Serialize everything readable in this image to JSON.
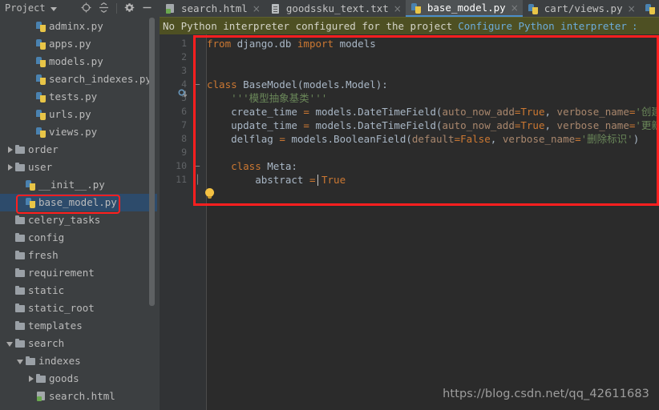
{
  "project_panel": {
    "title": "Project",
    "toolbar_icons": [
      {
        "name": "locate-icon",
        "glyph": "target"
      },
      {
        "name": "collapse-all-icon",
        "glyph": "collapse"
      },
      {
        "name": "settings-gear-icon",
        "glyph": "gear"
      },
      {
        "name": "hide-panel-icon",
        "glyph": "minus"
      }
    ],
    "tree": [
      {
        "label": "adminx.py",
        "icon": "python-file-icon",
        "indent": 3,
        "arrow": "none",
        "selected": false
      },
      {
        "label": "apps.py",
        "icon": "python-file-icon",
        "indent": 3,
        "arrow": "none",
        "selected": false
      },
      {
        "label": "models.py",
        "icon": "python-file-icon",
        "indent": 3,
        "arrow": "none",
        "selected": false
      },
      {
        "label": "search_indexes.py",
        "icon": "python-file-icon",
        "indent": 3,
        "arrow": "none",
        "selected": false
      },
      {
        "label": "tests.py",
        "icon": "python-file-icon",
        "indent": 3,
        "arrow": "none",
        "selected": false
      },
      {
        "label": "urls.py",
        "icon": "python-file-icon",
        "indent": 3,
        "arrow": "none",
        "selected": false
      },
      {
        "label": "views.py",
        "icon": "python-file-icon",
        "indent": 3,
        "arrow": "none",
        "selected": false
      },
      {
        "label": "order",
        "icon": "folder-icon",
        "indent": 1,
        "arrow": "closed",
        "selected": false
      },
      {
        "label": "user",
        "icon": "folder-icon",
        "indent": 1,
        "arrow": "closed",
        "selected": false
      },
      {
        "label": "__init__.py",
        "icon": "python-file-icon",
        "indent": 2,
        "arrow": "none",
        "selected": false
      },
      {
        "label": "base_model.py",
        "icon": "python-file-icon",
        "indent": 2,
        "arrow": "none",
        "selected": true
      },
      {
        "label": "celery_tasks",
        "icon": "folder-icon",
        "indent": 1,
        "arrow": "none",
        "selected": false
      },
      {
        "label": "config",
        "icon": "folder-icon",
        "indent": 1,
        "arrow": "none",
        "selected": false
      },
      {
        "label": "fresh",
        "icon": "folder-icon",
        "indent": 1,
        "arrow": "none",
        "selected": false
      },
      {
        "label": "requirement",
        "icon": "folder-icon",
        "indent": 1,
        "arrow": "none",
        "selected": false
      },
      {
        "label": "static",
        "icon": "folder-icon",
        "indent": 1,
        "arrow": "none",
        "selected": false
      },
      {
        "label": "static_root",
        "icon": "folder-icon",
        "indent": 1,
        "arrow": "none",
        "selected": false
      },
      {
        "label": "templates",
        "icon": "folder-icon",
        "indent": 1,
        "arrow": "none",
        "selected": false
      },
      {
        "label": "search",
        "icon": "folder-icon",
        "indent": 1,
        "arrow": "open",
        "selected": false
      },
      {
        "label": "indexes",
        "icon": "folder-icon",
        "indent": 2,
        "arrow": "open",
        "selected": false
      },
      {
        "label": "goods",
        "icon": "folder-icon",
        "indent": 3,
        "arrow": "closed",
        "selected": false
      },
      {
        "label": "search.html",
        "icon": "html-file-icon",
        "indent": 3,
        "arrow": "none",
        "selected": false
      }
    ]
  },
  "tabs": [
    {
      "label": "search.html",
      "icon": "html-file-icon",
      "active": false,
      "close": "×"
    },
    {
      "label": "goodssku_text.txt",
      "icon": "text-file-icon",
      "active": false,
      "close": "×"
    },
    {
      "label": "base_model.py",
      "icon": "python-file-icon",
      "active": true,
      "close": "×"
    },
    {
      "label": "cart/views.py",
      "icon": "python-file-icon",
      "active": false,
      "close": "×"
    },
    {
      "label": "",
      "icon": "python-file-icon",
      "active": false,
      "close": ""
    }
  ],
  "notification": {
    "message": "No Python interpreter configured for the project",
    "link": "Configure Python interpreter",
    "trailing": ":"
  },
  "editor": {
    "file": "base_model.py",
    "line_numbers": [
      "1",
      "2",
      "3",
      "4",
      "5",
      "6",
      "7",
      "8",
      "9",
      "10",
      "11"
    ],
    "lines": [
      {
        "n": 1,
        "segments": [
          {
            "t": "from ",
            "c": "kw"
          },
          {
            "t": "django.db ",
            "c": "plain"
          },
          {
            "t": "import ",
            "c": "kw"
          },
          {
            "t": "models",
            "c": "plain"
          }
        ]
      },
      {
        "n": 2,
        "segments": []
      },
      {
        "n": 3,
        "segments": []
      },
      {
        "n": 4,
        "segments": [
          {
            "t": "class ",
            "c": "kw"
          },
          {
            "t": "BaseModel(models.Model):",
            "c": "plain"
          }
        ]
      },
      {
        "n": 5,
        "segments": [
          {
            "t": "    '''模型抽象基类'''",
            "c": "str"
          }
        ]
      },
      {
        "n": 6,
        "segments": [
          {
            "t": "    create_time ",
            "c": "plain"
          },
          {
            "t": "= ",
            "c": "kw"
          },
          {
            "t": "models.DateTimeField(",
            "c": "plain"
          },
          {
            "t": "auto_now_add",
            "c": "named"
          },
          {
            "t": "=",
            "c": "kw"
          },
          {
            "t": "True",
            "c": "kw"
          },
          {
            "t": ", ",
            "c": "plain"
          },
          {
            "t": "verbose_name",
            "c": "named"
          },
          {
            "t": "=",
            "c": "kw"
          },
          {
            "t": "'创建时间'",
            "c": "str"
          },
          {
            "t": ")",
            "c": "plain"
          }
        ]
      },
      {
        "n": 7,
        "segments": [
          {
            "t": "    update_time ",
            "c": "plain"
          },
          {
            "t": "= ",
            "c": "kw"
          },
          {
            "t": "models.DateTimeField(",
            "c": "plain"
          },
          {
            "t": "auto_now_add",
            "c": "named"
          },
          {
            "t": "=",
            "c": "kw"
          },
          {
            "t": "True",
            "c": "kw"
          },
          {
            "t": ", ",
            "c": "plain"
          },
          {
            "t": "verbose_name",
            "c": "named"
          },
          {
            "t": "=",
            "c": "kw"
          },
          {
            "t": "'更新时间'",
            "c": "str"
          },
          {
            "t": ")",
            "c": "plain"
          }
        ]
      },
      {
        "n": 8,
        "segments": [
          {
            "t": "    delflag ",
            "c": "plain"
          },
          {
            "t": "= ",
            "c": "kw"
          },
          {
            "t": "models.BooleanField(",
            "c": "plain"
          },
          {
            "t": "default",
            "c": "named"
          },
          {
            "t": "=",
            "c": "kw"
          },
          {
            "t": "False",
            "c": "kw"
          },
          {
            "t": ", ",
            "c": "plain"
          },
          {
            "t": "verbose_name",
            "c": "named"
          },
          {
            "t": "=",
            "c": "kw"
          },
          {
            "t": "'删除标识'",
            "c": "str"
          },
          {
            "t": ")",
            "c": "plain"
          }
        ]
      },
      {
        "n": 9,
        "segments": []
      },
      {
        "n": 10,
        "segments": [
          {
            "t": "    class ",
            "c": "kw"
          },
          {
            "t": "Meta:",
            "c": "plain"
          }
        ]
      },
      {
        "n": 11,
        "segments": [
          {
            "t": "        abstract ",
            "c": "plain"
          },
          {
            "t": "= ",
            "c": "kw"
          },
          {
            "t": "True",
            "c": "kw"
          }
        ]
      }
    ],
    "gutter_icons": [
      {
        "name": "override-marker-icon",
        "line": 4
      },
      {
        "name": "intention-bulb-icon",
        "line": 11
      }
    ]
  },
  "annotations": {
    "tree_highlight_color": "#ff1f1f",
    "code_highlight_color": "#ff1f1f"
  },
  "watermark": "https://blog.csdn.net/qq_42611683"
}
